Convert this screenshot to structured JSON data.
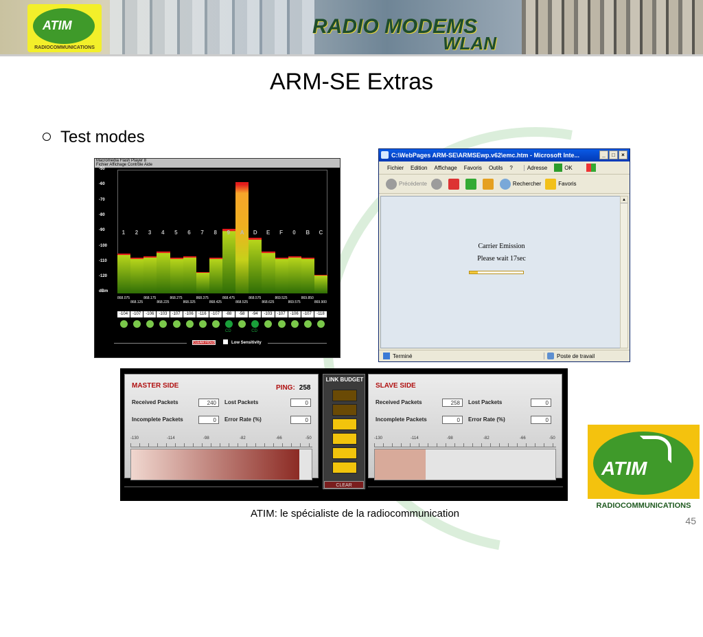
{
  "banner": {
    "logo_word": "ATIM",
    "logo_sub": "RADIOCOMMUNICATIONS",
    "title": "RADIO MODEMS",
    "subtitle": "WLAN"
  },
  "slide": {
    "title": "ARM-SE Extras",
    "bullet": "Test modes",
    "footer": "ATIM: le spécialiste de la radiocommunication",
    "page_number": "45"
  },
  "spectrum": {
    "titlebar": "Macromedia Flash Player 8",
    "menu": "Fichier  Affichage  Contrôle  Aide",
    "y_ticks": [
      "-50",
      "-60",
      "-70",
      "-80",
      "-90",
      "-100",
      "-110",
      "-120",
      "dBm"
    ],
    "channels": [
      "1",
      "2",
      "3",
      "4",
      "5",
      "6",
      "7",
      "8",
      "9",
      "A",
      "D",
      "E",
      "F",
      "0",
      "B",
      "C"
    ],
    "freqs": [
      "868.075",
      "868.125",
      "868.175",
      "868.225",
      "868.275",
      "868.325",
      "868.375",
      "868.425",
      "868.475",
      "868.525",
      "868.575",
      "868.625",
      "869.525",
      "869.575",
      "869.850",
      "869.900"
    ],
    "values": [
      "-104",
      "-107",
      "-106",
      "-103",
      "-107",
      "-106",
      "-116",
      "-107",
      "-88",
      "-58",
      "-94",
      "-103",
      "-107",
      "-106",
      "-107",
      "-118"
    ],
    "cd_labels": [
      "CD",
      "CD"
    ],
    "clear_hold": "CLEAR HOLD",
    "low_sensitivity": "Low Sensitivity"
  },
  "ie": {
    "title": "C:\\WebPages ARM-SE\\ARMSEwp.v62\\emc.htm - Microsoft Inte...",
    "menu": [
      "Fichier",
      "Edition",
      "Affichage",
      "Favoris",
      "Outils",
      "?"
    ],
    "address_label": "Adresse",
    "ok_label": "OK",
    "back_label": "Précédente",
    "search_label": "Rechercher",
    "favorites_label": "Favoris",
    "line1": "Carrier Emission",
    "line2": "Please wait 17sec",
    "progress_fraction": 0.15,
    "status_left": "Terminé",
    "status_right": "Poste de travail"
  },
  "link_budget": {
    "center_title": "LINK BUDGET",
    "clear": "CLEAR",
    "blocks_lit": 6,
    "master": {
      "title": "MASTER SIDE",
      "ping_label": "PING:",
      "ping_value": "258",
      "received_label": "Received Packets",
      "received_value": "240",
      "lost_label": "Lost Packets",
      "lost_value": "0",
      "incomplete_label": "Incomplete Packets",
      "incomplete_value": "0",
      "error_label": "Error Rate (%)",
      "error_value": "0",
      "ticks": [
        "-130",
        "-114",
        "-98",
        "-82",
        "-66",
        "-50"
      ],
      "level_fraction": 0.93
    },
    "slave": {
      "title": "SLAVE SIDE",
      "received_label": "Received Packets",
      "received_value": "258",
      "lost_label": "Lost Packets",
      "lost_value": "0",
      "incomplete_label": "Incomplete Packets",
      "incomplete_value": "0",
      "error_label": "Error Rate (%)",
      "error_value": "0",
      "ticks": [
        "-130",
        "-114",
        "-98",
        "-82",
        "-66",
        "-50"
      ],
      "level_fraction": 0.28
    }
  },
  "colors": {
    "bar_green": "#b7d51b",
    "bar_peak": "#f7a62a",
    "master_meter": "#8c2b24",
    "slave_meter": "#d8aa9a",
    "led_green": "#7ac84a"
  }
}
